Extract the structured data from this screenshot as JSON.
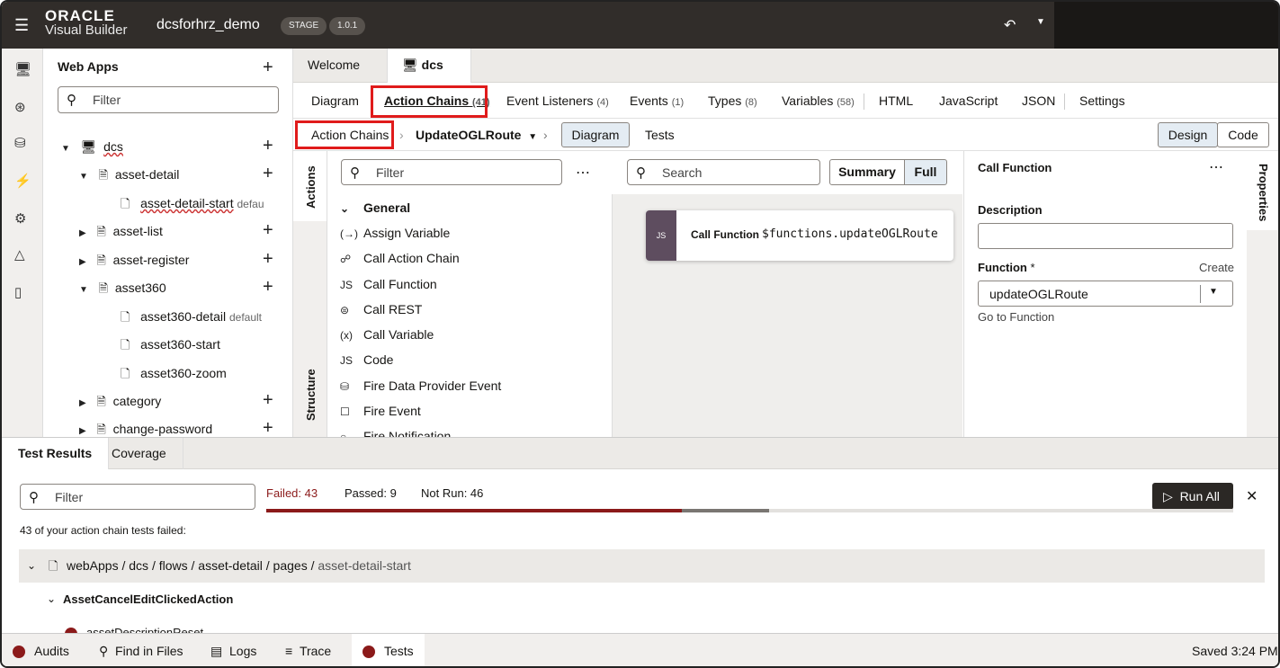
{
  "header": {
    "logo_top": "ORACLE",
    "logo_bottom": "Visual Builder",
    "app_name": "dcsforhrz_demo",
    "stage_badge": "STAGE",
    "version_badge": "1.0.1"
  },
  "web_apps": {
    "title": "Web Apps",
    "filter_placeholder": "Filter",
    "tree": [
      {
        "label": "dcs",
        "note": ""
      },
      {
        "label": "asset-detail",
        "note": ""
      },
      {
        "label": "asset-detail-start",
        "note": "defau"
      },
      {
        "label": "asset-list",
        "note": ""
      },
      {
        "label": "asset-register",
        "note": ""
      },
      {
        "label": "asset360",
        "note": ""
      },
      {
        "label": "asset360-detail",
        "note": "default"
      },
      {
        "label": "asset360-start",
        "note": ""
      },
      {
        "label": "asset360-zoom",
        "note": ""
      },
      {
        "label": "category",
        "note": ""
      },
      {
        "label": "change-password",
        "note": ""
      }
    ]
  },
  "editor_tabs": {
    "welcome": "Welcome",
    "dcs": "dcs"
  },
  "sub_tabs": [
    {
      "label": "Diagram",
      "count": ""
    },
    {
      "label": "Action Chains",
      "count": "(41)"
    },
    {
      "label": "Event Listeners",
      "count": "(4)"
    },
    {
      "label": "Events",
      "count": "(1)"
    },
    {
      "label": "Types",
      "count": "(8)"
    },
    {
      "label": "Variables",
      "count": "(58)"
    },
    {
      "label": "HTML",
      "count": ""
    },
    {
      "label": "JavaScript",
      "count": ""
    },
    {
      "label": "JSON",
      "count": ""
    },
    {
      "label": "Settings",
      "count": ""
    }
  ],
  "breadcrumb": {
    "root": "Action Chains",
    "chain": "UpdateOGLRoute",
    "diagram": "Diagram",
    "tests": "Tests",
    "design": "Design",
    "code": "Code"
  },
  "actions_panel": {
    "vtab_actions": "Actions",
    "vtab_structure": "Structure",
    "filter_placeholder": "Filter",
    "group": "General",
    "items": [
      {
        "icon": "(→)",
        "label": "Assign Variable"
      },
      {
        "icon": "☍",
        "label": "Call Action Chain"
      },
      {
        "icon": "JS",
        "label": "Call Function"
      },
      {
        "icon": "⊜",
        "label": "Call REST"
      },
      {
        "icon": "(x)",
        "label": "Call Variable"
      },
      {
        "icon": "JS",
        "label": "Code"
      },
      {
        "icon": "⛁",
        "label": "Fire Data Provider Event"
      },
      {
        "icon": "☐",
        "label": "Fire Event"
      },
      {
        "icon": "○",
        "label": "Fire Notification"
      }
    ]
  },
  "canvas": {
    "search_placeholder": "Search",
    "summary": "Summary",
    "full": "Full",
    "card_title": "Call Function",
    "card_value": "$functions.updateOGLRoute",
    "card_badge": "JS"
  },
  "properties": {
    "title": "Call Function",
    "description_label": "Description",
    "description_value": "",
    "function_label": "Function",
    "required_mark": "*",
    "create": "Create",
    "function_value": "updateOGLRoute",
    "go_to": "Go to Function",
    "rail_label": "Properties"
  },
  "bottom_tabs": {
    "results": "Test Results",
    "coverage": "Coverage"
  },
  "tests": {
    "filter_placeholder": "Filter",
    "failed": "Failed: 43",
    "passed": "Passed: 9",
    "not_run": "Not Run: 46",
    "failed_fraction": 0.43,
    "passed_fraction": 0.09,
    "run_all": "Run All",
    "summary": "43 of your action chain tests failed:",
    "path_main": "webApps / dcs / flows / asset-detail / pages /",
    "path_tail": " asset-detail-start",
    "action": "AssetCancelEditClickedAction",
    "partial_row": "assetDescriptionReset"
  },
  "status_bar": {
    "audits": "Audits",
    "find": "Find in Files",
    "logs": "Logs",
    "trace": "Trace",
    "tests": "Tests",
    "saved": "Saved 3:24 PM"
  }
}
